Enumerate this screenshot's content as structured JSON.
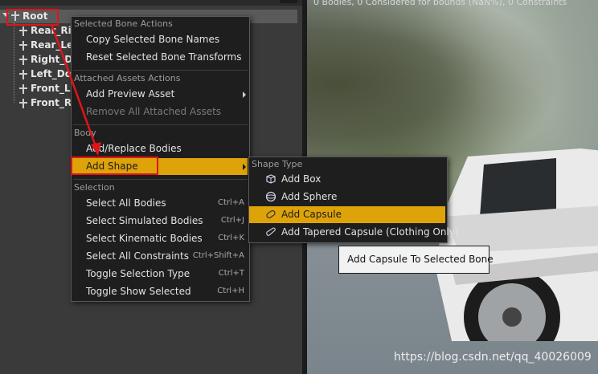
{
  "skeleton_tree": {
    "root_label": "Root",
    "bones": [
      "Rear_Rig",
      "Rear_Lef",
      "Right_Do",
      "Left_Doo",
      "Front_Le",
      "Front_Rig"
    ]
  },
  "viewport": {
    "info": "0 Bodies, 0 Considered for bounds (NaN%), 0 Constraints",
    "watermark": "https://blog.csdn.net/qq_40026009"
  },
  "context_menu": {
    "sections": [
      {
        "header": "Selected Bone Actions",
        "items": [
          {
            "label": "Copy Selected Bone Names",
            "shortcut": ""
          },
          {
            "label": "Reset Selected Bone Transforms",
            "shortcut": ""
          }
        ]
      },
      {
        "header": "Attached Assets Actions",
        "items": [
          {
            "label": "Add Preview Asset",
            "shortcut": ""
          },
          {
            "label": "Remove All Attached Assets",
            "shortcut": ""
          }
        ]
      },
      {
        "header": "Body",
        "items": [
          {
            "label": "Add/Replace Bodies",
            "shortcut": ""
          },
          {
            "label": "Add Shape",
            "shortcut": ""
          }
        ]
      },
      {
        "header": "Selection",
        "items": [
          {
            "label": "Select All Bodies",
            "shortcut": "Ctrl+A"
          },
          {
            "label": "Select Simulated Bodies",
            "shortcut": "Ctrl+J"
          },
          {
            "label": "Select Kinematic Bodies",
            "shortcut": "Ctrl+K"
          },
          {
            "label": "Select All Constraints",
            "shortcut": "Ctrl+Shift+A"
          },
          {
            "label": "Toggle Selection Type",
            "shortcut": "Ctrl+T"
          },
          {
            "label": "Toggle Show Selected",
            "shortcut": "Ctrl+H"
          }
        ]
      }
    ]
  },
  "shape_submenu": {
    "header": "Shape Type",
    "items": [
      {
        "label": "Add Box",
        "icon": "box-shape-icon"
      },
      {
        "label": "Add Sphere",
        "icon": "sphere-shape-icon"
      },
      {
        "label": "Add Capsule",
        "icon": "capsule-shape-icon"
      },
      {
        "label": "Add Tapered Capsule (Clothing Only)",
        "icon": "tapered-capsule-icon"
      }
    ]
  },
  "tooltip": {
    "text": "Add Capsule To Selected Bone"
  },
  "colors": {
    "highlight": "#dea309",
    "annotation": "#e0141b",
    "menu_bg": "#1e1e1e"
  }
}
